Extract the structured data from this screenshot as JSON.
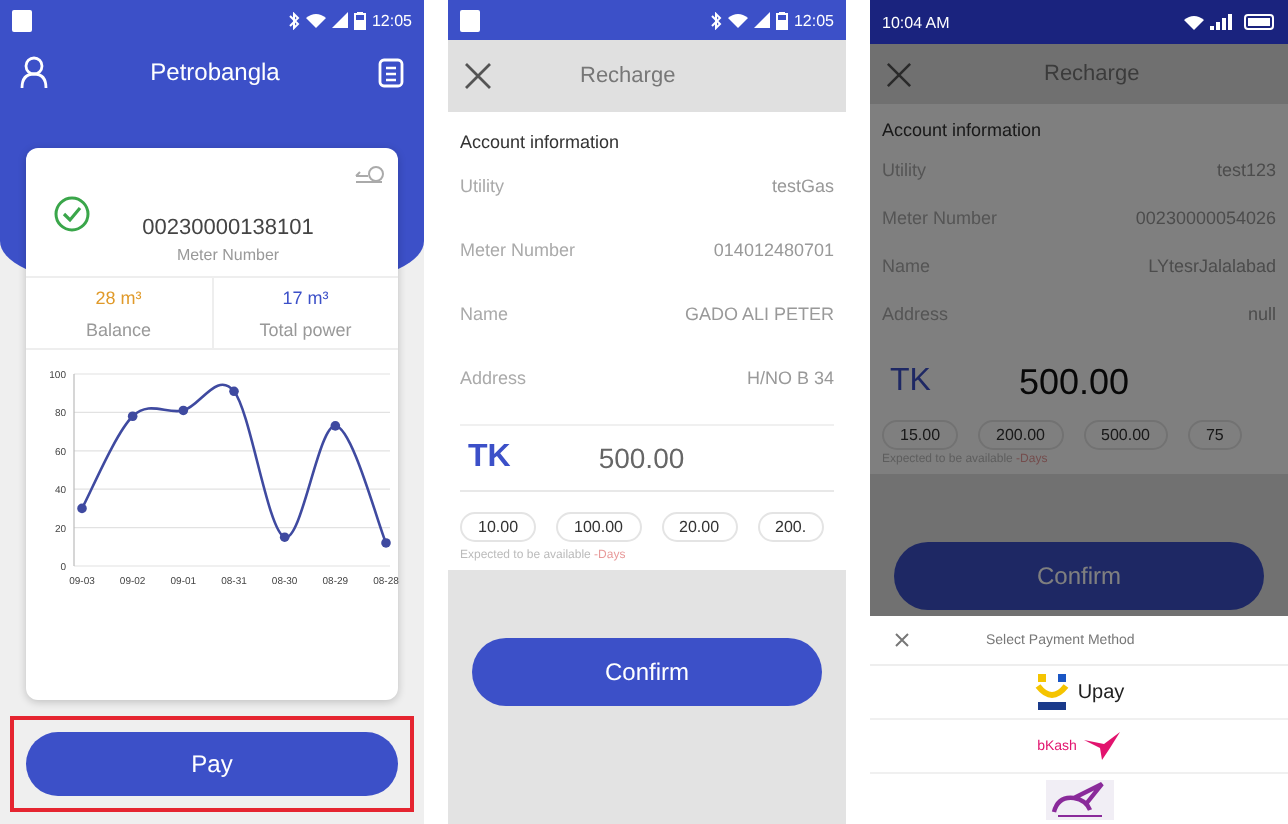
{
  "home_screen": {
    "status_time": "12:05",
    "title": "Petrobangla",
    "meter_number": "00230000138101",
    "meter_label": "Meter Number",
    "balance_value": "28 m³",
    "balance_label": "Balance",
    "total_value": "17 m³",
    "total_label": "Total power",
    "chart_data": {
      "type": "line",
      "categories": [
        "09-03",
        "09-02",
        "09-01",
        "08-31",
        "08-30",
        "08-29",
        "08-28"
      ],
      "series": [
        {
          "color": "#3f4aa0",
          "marker": true,
          "values": [
            30,
            78,
            81,
            91,
            15,
            73,
            12
          ]
        }
      ],
      "ylim": [
        0,
        100
      ],
      "yticks": [
        0,
        20,
        40,
        60,
        80,
        100
      ],
      "grid": true
    },
    "pay_button": "Pay",
    "highlighted": true
  },
  "recharge_screen": {
    "status_time": "12:05",
    "title": "Recharge",
    "section": "Account information",
    "fields": [
      {
        "label": "Utility",
        "value": "testGas"
      },
      {
        "label": "Meter Number",
        "value": "014012480701"
      },
      {
        "label": "Name",
        "value": "GADO ALI PETER"
      },
      {
        "label": "Address",
        "value": "H/NO B 34"
      }
    ],
    "currency": "TK",
    "amount": "500.00",
    "amounts": [
      "10.00",
      "100.00",
      "20.00",
      "200."
    ],
    "expected_label": "Expected to be available",
    "expected_value": "-Days",
    "confirm_button": "Confirm"
  },
  "payment_screen": {
    "status_time": "10:04 AM",
    "title": "Recharge",
    "section": "Account information",
    "fields": [
      {
        "label": "Utility",
        "value": "test123"
      },
      {
        "label": "Meter Number",
        "value": "00230000054026"
      },
      {
        "label": "Name",
        "value": "LYtesrJalalabad"
      },
      {
        "label": "Address",
        "value": "null"
      }
    ],
    "currency": "TK",
    "amount": "500.00",
    "amounts": [
      "15.00",
      "200.00",
      "500.00",
      "75"
    ],
    "expected_label": "Expected to be available",
    "expected_value": "-Days",
    "confirm_button": "Confirm",
    "sheet": {
      "title": "Select Payment Method",
      "methods": [
        {
          "kind": "upay",
          "label": "Upay"
        },
        {
          "kind": "bkash",
          "label": "bKash"
        },
        {
          "kind": "rocket"
        }
      ]
    }
  }
}
